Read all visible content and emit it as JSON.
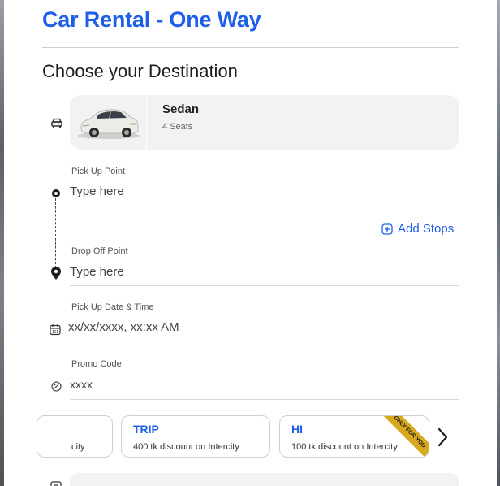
{
  "page": {
    "title": "Car Rental - One Way",
    "subtitle": "Choose your Destination"
  },
  "vehicle": {
    "name": "Sedan",
    "seats": "4 Seats",
    "icon": "car-icon"
  },
  "pickup": {
    "label": "Pick Up Point",
    "placeholder": "Type here",
    "icon": "location-dot-icon"
  },
  "add_stops": {
    "label": "Add Stops",
    "icon": "plus-square-icon"
  },
  "dropoff": {
    "label": "Drop Off Point",
    "placeholder": "Type here",
    "icon": "map-pin-icon"
  },
  "datetime": {
    "label": "Pick Up Date & Time",
    "placeholder": "xx/xx/xxxx, xx:xx AM",
    "icon": "calendar-icon"
  },
  "promo": {
    "label": "Promo Code",
    "placeholder": "xxxx",
    "icon": "discount-icon"
  },
  "promo_offers": [
    {
      "code": "",
      "description": "city"
    },
    {
      "code": "TRIP",
      "description": "400 tk discount on Intercity"
    },
    {
      "code": "HI",
      "description": "100 tk discount on Intercity",
      "ribbon": "ONLY FOR YOU"
    }
  ],
  "colors": {
    "accent": "#1f5ee8",
    "ribbon": "#d8a91f",
    "card_bg": "#f2f2f4"
  }
}
